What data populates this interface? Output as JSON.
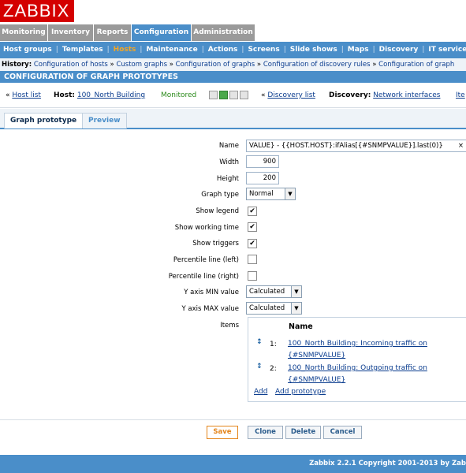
{
  "app": {
    "logo": "ZABBIX"
  },
  "topmenu": [
    "Monitoring",
    "Inventory",
    "Reports",
    "Configuration",
    "Administration"
  ],
  "submenu": [
    "Host groups",
    "Templates",
    "Hosts",
    "Maintenance",
    "Actions",
    "Screens",
    "Slide shows",
    "Maps",
    "Discovery",
    "IT services"
  ],
  "history": {
    "label": "History:",
    "crumbs": [
      "Configuration of hosts",
      "Custom graphs",
      "Configuration of graphs",
      "Configuration of discovery rules",
      "Configuration of graph"
    ]
  },
  "page": {
    "title": "CONFIGURATION OF GRAPH PROTOTYPES"
  },
  "hostbar": {
    "host_list": "Host list",
    "host_label": "Host:",
    "host_name": "100_North Building",
    "status": "Monitored",
    "status_icons": [
      "Z",
      "SNMP",
      "JMX",
      "IPMI"
    ],
    "discovery_list": "Discovery list",
    "discovery_label": "Discovery:",
    "discovery_value": "Network interfaces",
    "next": "Ite"
  },
  "tabs": [
    "Graph prototype",
    "Preview"
  ],
  "form": {
    "name_label": "Name",
    "name_value": "VALUE} - {{HOST.HOST}:ifAlias[{#SNMPVALUE}].last(0)}",
    "width_label": "Width",
    "width_value": "900",
    "height_label": "Height",
    "height_value": "200",
    "graph_type_label": "Graph type",
    "graph_type_value": "Normal",
    "show_legend_label": "Show legend",
    "show_working_time_label": "Show working time",
    "show_triggers_label": "Show triggers",
    "percentile_left_label": "Percentile line (left)",
    "percentile_right_label": "Percentile line (right)",
    "ymin_label": "Y axis MIN value",
    "ymin_value": "Calculated",
    "ymax_label": "Y axis MAX value",
    "ymax_value": "Calculated",
    "items_label": "Items",
    "items_header": "Name",
    "items": [
      {
        "num": "1:",
        "name": "100_North Building: Incoming traffic on {#SNMPVALUE}"
      },
      {
        "num": "2:",
        "name": "100_North Building: Outgoing traffic on {#SNMPVALUE}"
      }
    ],
    "add_label": "Add",
    "add_prototype_label": "Add prototype"
  },
  "buttons": {
    "save": "Save",
    "clone": "Clone",
    "delete": "Delete",
    "cancel": "Cancel"
  },
  "footer": {
    "copyright": "Zabbix 2.2.1 Copyright 2001-2013 by Zab"
  },
  "colors": {
    "accent": "#4a8ec9",
    "brand": "#d40000",
    "active_submenu": "#f5a623",
    "monitored": "#2a8a1a"
  }
}
